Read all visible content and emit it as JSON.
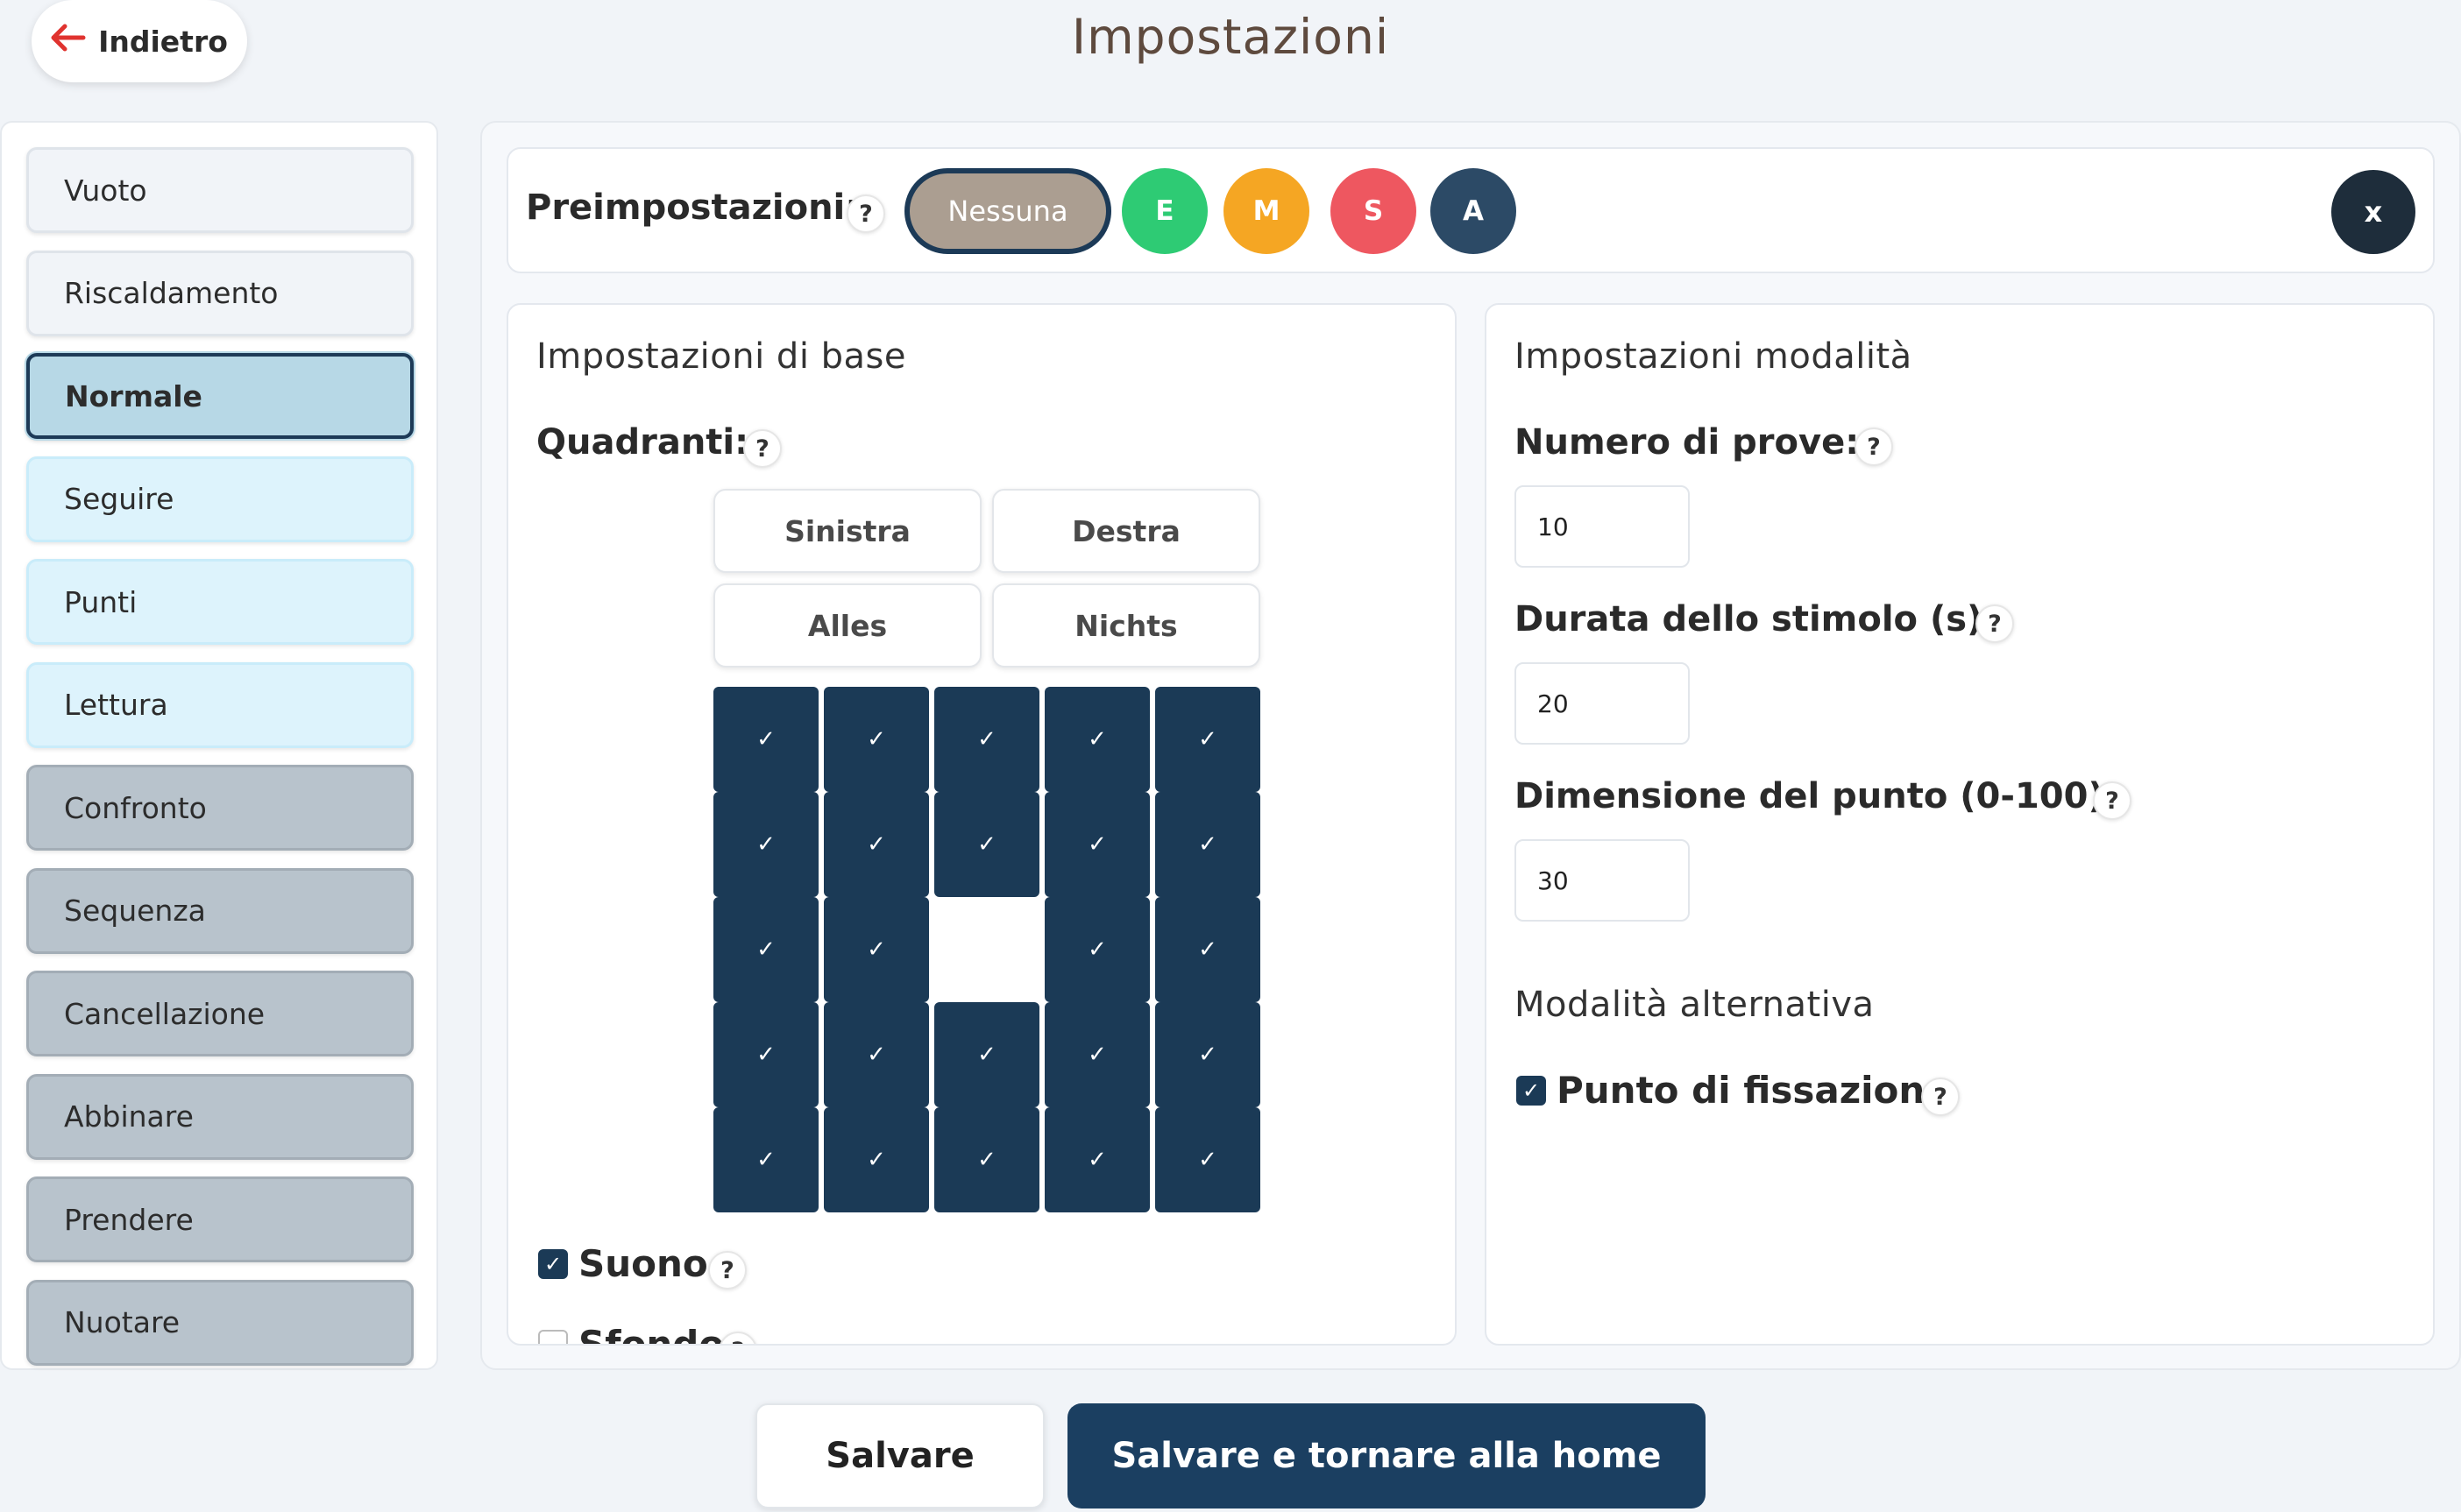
{
  "header": {
    "back_label": "Indietro",
    "title": "Impostazioni"
  },
  "sidebar": {
    "items": [
      {
        "label": "Vuoto",
        "style": "light",
        "selected": false
      },
      {
        "label": "Riscaldamento",
        "style": "light",
        "selected": false
      },
      {
        "label": "Normale",
        "style": "blue",
        "selected": true
      },
      {
        "label": "Seguire",
        "style": "blue",
        "selected": false
      },
      {
        "label": "Punti",
        "style": "blue",
        "selected": false
      },
      {
        "label": "Lettura",
        "style": "blue",
        "selected": false
      },
      {
        "label": "Confronto",
        "style": "gray",
        "selected": false
      },
      {
        "label": "Sequenza",
        "style": "gray",
        "selected": false
      },
      {
        "label": "Cancellazione",
        "style": "gray",
        "selected": false
      },
      {
        "label": "Abbinare",
        "style": "gray",
        "selected": false
      },
      {
        "label": "Prendere",
        "style": "gray",
        "selected": false
      },
      {
        "label": "Nuotare",
        "style": "gray",
        "selected": false
      }
    ]
  },
  "presets": {
    "label": "Preimpostazioni:",
    "help": "?",
    "none_label": "Nessuna",
    "levels": [
      {
        "label": "E",
        "color": "#2ecb74"
      },
      {
        "label": "M",
        "color": "#f5a623"
      },
      {
        "label": "S",
        "color": "#ee5760"
      },
      {
        "label": "A",
        "color": "#2c4a66"
      }
    ],
    "close_label": "x"
  },
  "basic": {
    "title": "Impostazioni di base",
    "quadrants_label": "Quadranti:",
    "help": "?",
    "buttons": {
      "left": "Sinistra",
      "right": "Destra",
      "all": "Alles",
      "none": "Nichts"
    },
    "check_glyph": "✓",
    "grid": [
      [
        true,
        true,
        true,
        true,
        true
      ],
      [
        true,
        true,
        true,
        true,
        true
      ],
      [
        true,
        true,
        false,
        true,
        true
      ],
      [
        true,
        true,
        true,
        true,
        true
      ],
      [
        true,
        true,
        true,
        true,
        true
      ]
    ],
    "sound_label": "Suono",
    "sound_checked": true,
    "background_label": "Sfondo",
    "background_checked": false
  },
  "mode": {
    "title": "Impostazioni modalità",
    "help": "?",
    "trials_label": "Numero di prove:",
    "trials_value": "10",
    "duration_label": "Durata dello stimolo (s):",
    "duration_value": "20",
    "dot_size_label": "Dimensione del punto (0-100):",
    "dot_size_value": "30",
    "alt_title": "Modalità alternativa",
    "fixation_label": "Punto di fissazione",
    "fixation_checked": true
  },
  "footer": {
    "save_label": "Salvare",
    "save_home_label": "Salvare e tornare alla home"
  }
}
